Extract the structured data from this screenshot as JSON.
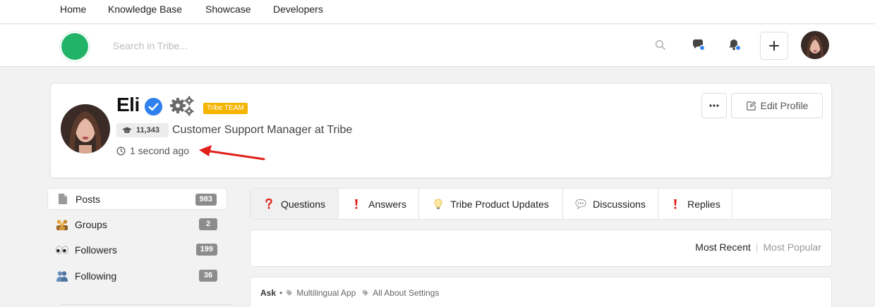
{
  "topnav": {
    "links": [
      "Home",
      "Knowledge Base",
      "Showcase",
      "Developers"
    ]
  },
  "header": {
    "search_placeholder": "Search in Tribe..."
  },
  "profile": {
    "name": "Eli",
    "badge": "Tribe TEAM",
    "reputation": "11,343",
    "title": "Customer Support Manager at Tribe",
    "last_seen": "1 second ago",
    "edit_label": "Edit Profile"
  },
  "sidebar": {
    "items": [
      {
        "label": "Posts",
        "count": "983"
      },
      {
        "label": "Groups",
        "count": "2"
      },
      {
        "label": "Followers",
        "count": "199"
      },
      {
        "label": "Following",
        "count": "36"
      }
    ]
  },
  "tabs": [
    "Questions",
    "Answers",
    "Tribe Product Updates",
    "Discussions",
    "Replies"
  ],
  "sort": {
    "recent": "Most Recent",
    "popular": "Most Popular"
  },
  "post": {
    "type": "Ask",
    "tags": [
      "Multilingual App",
      "All About Settings"
    ]
  },
  "colors": {
    "brand": "#21b469",
    "badge": "#f5b400",
    "verified": "#2f80ed",
    "arrow": "#e0201b"
  }
}
